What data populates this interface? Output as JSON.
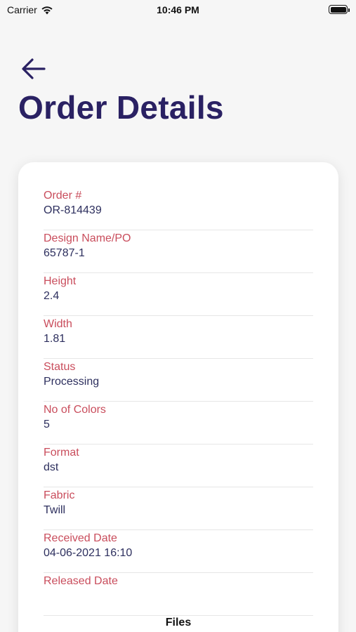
{
  "status_bar": {
    "carrier": "Carrier",
    "time": "10:46 PM"
  },
  "header": {
    "title": "Order Details",
    "back_icon": "arrow-left-icon"
  },
  "fields": [
    {
      "label": "Order #",
      "value": "OR-814439"
    },
    {
      "label": "Design Name/PO",
      "value": "65787-1"
    },
    {
      "label": "Height",
      "value": "2.4"
    },
    {
      "label": "Width",
      "value": "1.81"
    },
    {
      "label": "Status",
      "value": "Processing"
    },
    {
      "label": "No of Colors",
      "value": "5"
    },
    {
      "label": "Format",
      "value": "dst"
    },
    {
      "label": "Fabric",
      "value": "Twill"
    },
    {
      "label": "Received Date",
      "value": "04-06-2021 16:10"
    },
    {
      "label": "Released Date",
      "value": ""
    }
  ],
  "files_section": {
    "label": "Files"
  },
  "colors": {
    "title": "#2a2163",
    "label": "#c94d5c",
    "value": "#2d2f5e",
    "background": "#f6f6f6",
    "card": "#ffffff"
  }
}
